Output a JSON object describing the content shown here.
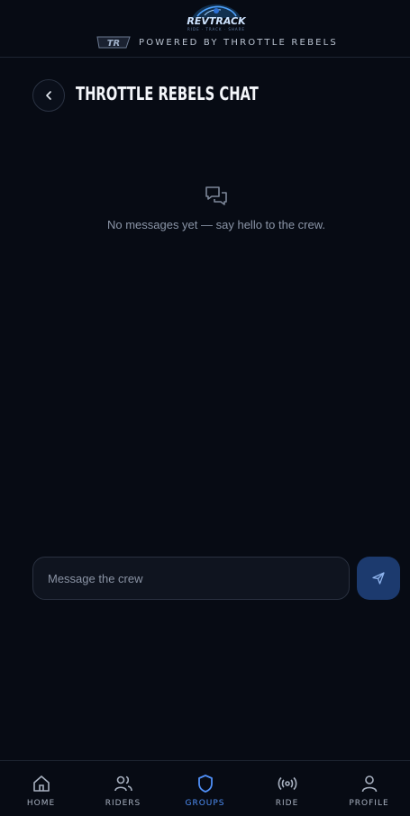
{
  "brand": {
    "logo_text": "REVTRACK",
    "logo_subtext": "RIDE · TRACK · SHARE",
    "badge_text": "TR",
    "powered_by": "POWERED BY THROTTLE REBELS"
  },
  "page": {
    "title": "THROTTLE REBELS CHAT"
  },
  "empty_state": {
    "message": "No messages yet — say hello to the crew."
  },
  "composer": {
    "placeholder": "Message the crew",
    "value": ""
  },
  "nav": {
    "items": [
      {
        "label": "HOME",
        "icon": "home-icon"
      },
      {
        "label": "RIDERS",
        "icon": "riders-icon"
      },
      {
        "label": "GROUPS",
        "icon": "shield-icon",
        "active": true
      },
      {
        "label": "RIDE",
        "icon": "broadcast-icon"
      },
      {
        "label": "PROFILE",
        "icon": "profile-icon"
      }
    ]
  },
  "colors": {
    "background": "#070b14",
    "accent": "#4f8ff7",
    "send_button": "#1c3a6e"
  }
}
